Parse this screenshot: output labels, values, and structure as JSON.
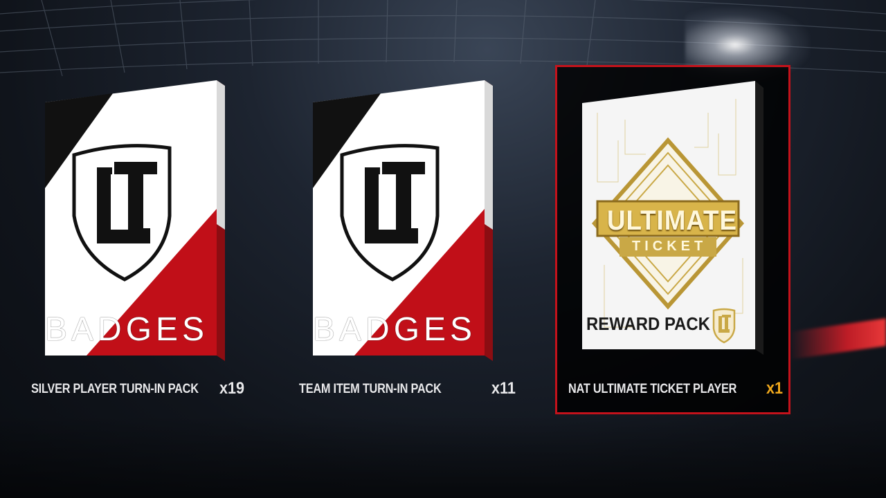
{
  "theme": {
    "accent_red": "#c4121b",
    "count_highlight": "#f0a81c",
    "label_color": "#e8e8ea"
  },
  "packs": [
    {
      "label": "SILVER PLAYER TURN-IN PACK",
      "count": "x19",
      "art_text": "BADGES",
      "icon": "ut-shield-icon",
      "selected": false
    },
    {
      "label": "TEAM ITEM TURN-IN PACK",
      "count": "x11",
      "art_text": "BADGES",
      "icon": "ut-shield-icon",
      "selected": false
    },
    {
      "label": "NAT ULTIMATE TICKET PLAYER",
      "count": "x1",
      "art_title": "ULTIMATE",
      "art_subtitle": "TICKET",
      "art_text": "REWARD PACK",
      "icon": "ut-gold-shield-icon",
      "selected": true
    }
  ]
}
